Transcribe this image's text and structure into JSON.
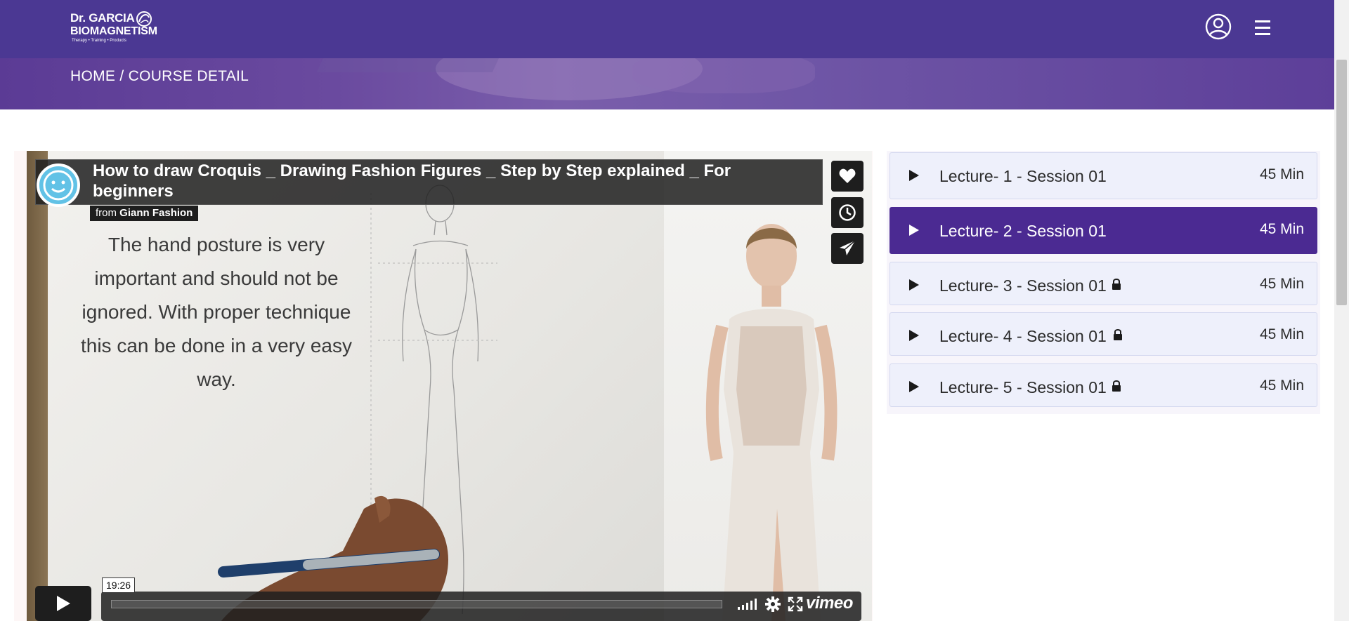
{
  "header": {
    "logo": {
      "line1": "Dr. GARCIA",
      "line2": "BIOMAGNETISM",
      "line3": "Therapy • Training • Products"
    },
    "icons": {
      "user": "user-circle-icon",
      "menu": "hamburger-menu-icon"
    },
    "brand_color": "#4b3893"
  },
  "banner": {
    "breadcrumb_home": "HOME",
    "breadcrumb_sep": " / ",
    "breadcrumb_current": "COURSE DETAIL"
  },
  "video": {
    "title": "How to draw Croquis _ Drawing Fashion Figures _ Step by Step explained _ For beginners",
    "from_label": "from",
    "author": "Giann Fashion",
    "overlay_text": "The hand posture is very important and should not be ignored. With proper technique this can be done in a very easy way.",
    "time": "19:26",
    "player_brand": "vimeo",
    "side_buttons": [
      "heart-icon",
      "clock-icon",
      "paper-plane-icon"
    ]
  },
  "lectures": [
    {
      "label": "Lecture- 1 - Session 01",
      "duration": "45 Min",
      "locked": false,
      "active": false
    },
    {
      "label": "Lecture- 2 - Session 01",
      "duration": "45 Min",
      "locked": false,
      "active": true
    },
    {
      "label": "Lecture- 3 - Session 01",
      "duration": "45 Min",
      "locked": true,
      "active": false
    },
    {
      "label": "Lecture- 4 - Session 01",
      "duration": "45 Min",
      "locked": true,
      "active": false
    },
    {
      "label": "Lecture- 5 - Session 01",
      "duration": "45 Min",
      "locked": true,
      "active": false
    }
  ],
  "colors": {
    "active_lecture": "#4b2a92",
    "lecture_bg": "#eef0fb"
  }
}
